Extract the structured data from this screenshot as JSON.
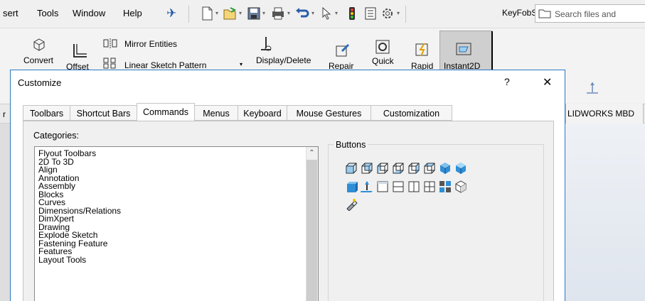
{
  "menubar": {
    "items": [
      "sert",
      "Tools",
      "Window",
      "Help"
    ],
    "document_title": "KeyFobSoFar....",
    "search_placeholder": "Search files and"
  },
  "ribbon": {
    "convert_label": "Convert",
    "offset_label": "Offset",
    "mirror_label": "Mirror Entities",
    "linear_pattern_label": "Linear Sketch Pattern",
    "display_delete_label": "Display/Delete",
    "repair_label": "Repair",
    "quick_label": "Quick",
    "rapid_label": "Rapid",
    "instant2d_label": "Instant2D"
  },
  "feature_strip": {
    "left_fragment": "r",
    "mbd_tab": "LIDWORKS MBD"
  },
  "dialog": {
    "title": "Customize",
    "help_symbol": "?",
    "close_symbol": "✕",
    "tabs": [
      "Toolbars",
      "Shortcut Bars",
      "Commands",
      "Menus",
      "Keyboard",
      "Mouse Gestures",
      "Customization"
    ],
    "active_tab": "Commands",
    "categories_label": "Categories:",
    "categories": [
      "Flyout Toolbars",
      "2D To 3D",
      "Align",
      "Annotation",
      "Assembly",
      "Blocks",
      "Curves",
      "Dimensions/Relations",
      "DimXpert",
      "Drawing",
      "Explode Sketch",
      "Fastening Feature",
      "Features",
      "Layout Tools"
    ],
    "buttons_label": "Buttons",
    "button_icons": [
      "isometric-view-icon",
      "trimetric-view-icon",
      "dimetric-view-icon",
      "front-view-icon",
      "back-view-icon",
      "left-view-icon",
      "shaded-cube-icon",
      "shaded-with-edges-icon",
      "solid-cube-icon",
      "normal-to-icon",
      "single-view-icon",
      "two-view-horizontal-icon",
      "two-view-vertical-icon",
      "four-view-icon",
      "link-views-icon",
      "view-cube-icon",
      "flashlight-icon"
    ]
  },
  "colors": {
    "accent": "#2b78c4",
    "icon_blue": "#2f8fd6",
    "selected_tab_bg": "#cfcfcf"
  }
}
